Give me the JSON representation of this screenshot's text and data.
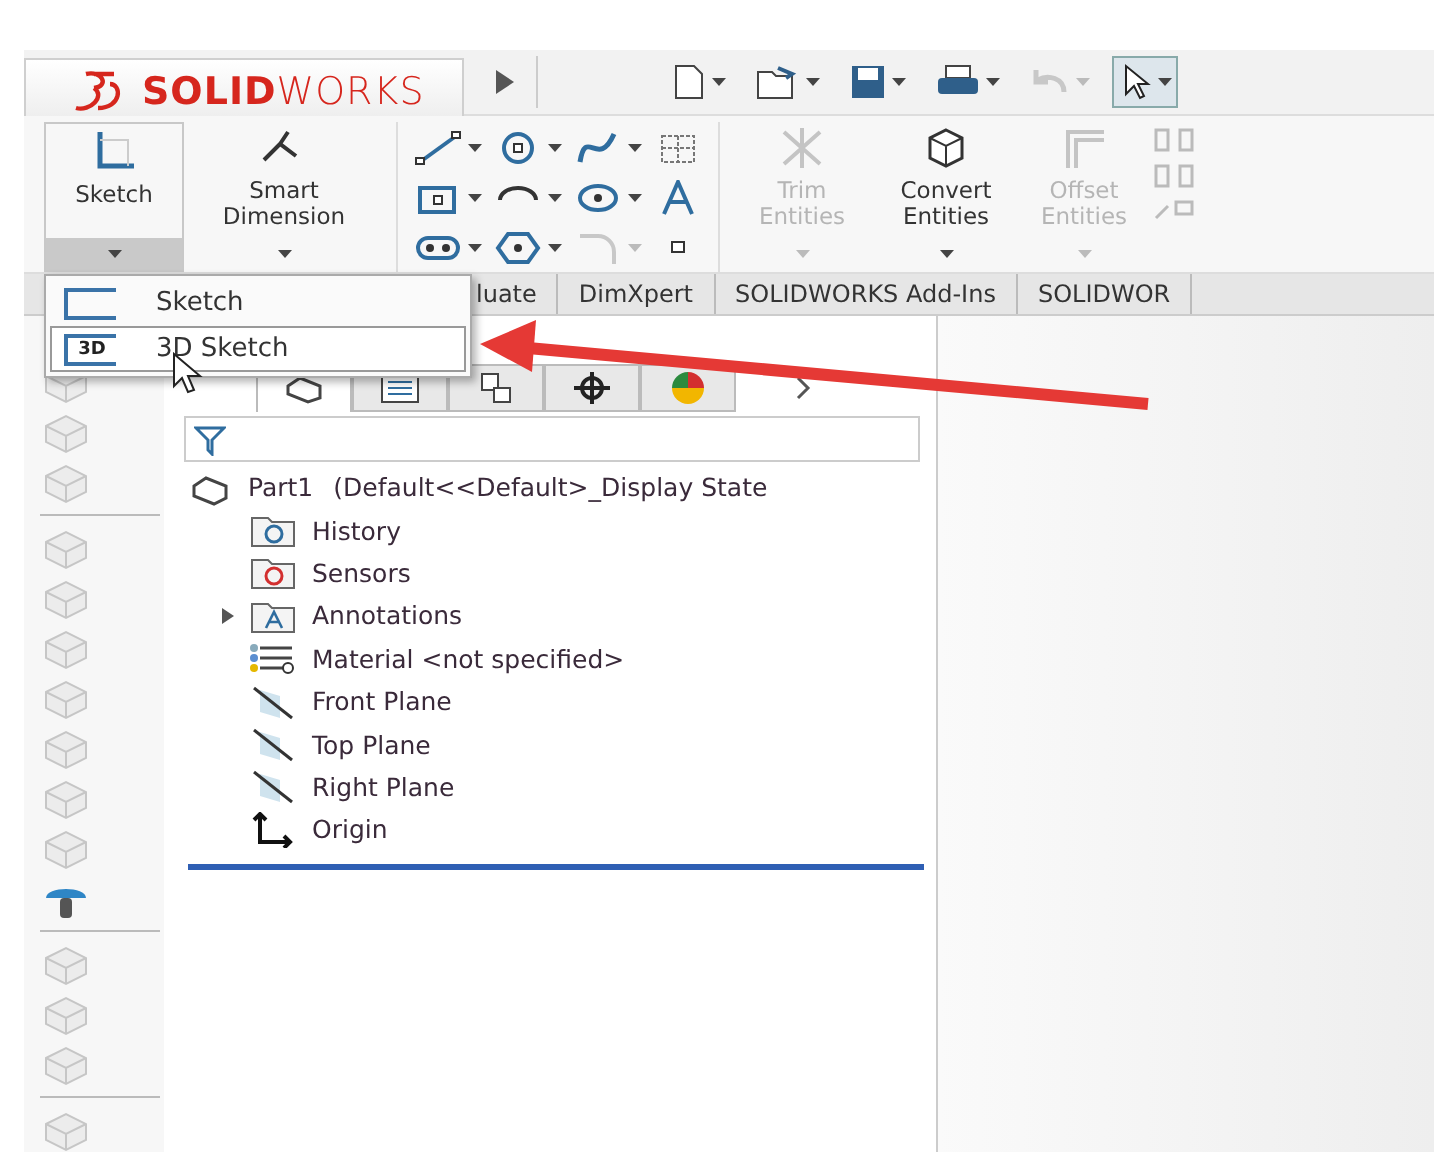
{
  "logo": {
    "text": "**SOLID**WORKS"
  },
  "quick_access": [
    {
      "kind": "new",
      "disabled": false
    },
    {
      "kind": "open",
      "disabled": false
    },
    {
      "kind": "save",
      "disabled": false
    },
    {
      "kind": "print",
      "disabled": false
    },
    {
      "kind": "undo",
      "disabled": true
    },
    {
      "kind": "select",
      "disabled": false,
      "selected": true
    }
  ],
  "ribbon": {
    "buttons": [
      {
        "kind": "sketch",
        "label": "Sketch",
        "disabled": false,
        "open": true
      },
      {
        "kind": "dimension",
        "label": "Smart Dimension",
        "disabled": false,
        "open": false
      },
      {
        "kind": "trim",
        "label": "Trim Entities",
        "disabled": true,
        "open": false
      },
      {
        "kind": "convert",
        "label": "Convert Entities",
        "disabled": false,
        "open": false
      },
      {
        "kind": "offset",
        "label": "Offset Entities",
        "disabled": true,
        "open": false
      }
    ],
    "tools": [
      {
        "kind": "line",
        "disabled": false
      },
      {
        "kind": "circle",
        "disabled": false
      },
      {
        "kind": "spline",
        "disabled": false
      },
      {
        "kind": "grid",
        "disabled": false
      },
      {
        "kind": "rect",
        "disabled": false
      },
      {
        "kind": "arc",
        "disabled": false
      },
      {
        "kind": "ellipse",
        "disabled": false
      },
      {
        "kind": "text",
        "disabled": false
      },
      {
        "kind": "slot",
        "disabled": false
      },
      {
        "kind": "polygon",
        "disabled": false
      },
      {
        "kind": "fillet",
        "disabled": true
      },
      {
        "kind": "point",
        "disabled": false
      }
    ]
  },
  "tabs": [
    "luate",
    "DimXpert",
    "SOLIDWORKS Add-Ins",
    "SOLIDWOR"
  ],
  "menu": [
    {
      "label": "Sketch",
      "selected": false
    },
    {
      "label": "3D Sketch",
      "icon_text": "3D",
      "selected": true
    }
  ],
  "left_toolbar": [
    {
      "kind": "tool",
      "disabled": true
    },
    {
      "kind": "tool",
      "disabled": true
    },
    {
      "kind": "tool",
      "disabled": true
    },
    {
      "kind": "separator"
    },
    {
      "kind": "tool",
      "disabled": true
    },
    {
      "kind": "tool",
      "disabled": true
    },
    {
      "kind": "tool",
      "disabled": true
    },
    {
      "kind": "tool",
      "disabled": true
    },
    {
      "kind": "tool",
      "disabled": true
    },
    {
      "kind": "tool",
      "disabled": true
    },
    {
      "kind": "tool",
      "disabled": true
    },
    {
      "kind": "tool",
      "disabled": false
    },
    {
      "kind": "separator"
    },
    {
      "kind": "tool",
      "disabled": true
    },
    {
      "kind": "tool",
      "disabled": true
    },
    {
      "kind": "tool",
      "disabled": true
    },
    {
      "kind": "separator"
    },
    {
      "kind": "tool",
      "disabled": true
    }
  ],
  "panel_tabs": [
    {
      "kind": "tree",
      "selected": true
    },
    {
      "kind": "properties",
      "selected": false
    },
    {
      "kind": "config",
      "selected": false
    },
    {
      "kind": "target",
      "selected": false
    },
    {
      "kind": "appearance",
      "selected": false
    }
  ],
  "tree": {
    "root": {
      "name": "Part1",
      "config": "(Default<<Default>_Display State"
    },
    "items": [
      {
        "kind": "history",
        "label": "History"
      },
      {
        "kind": "sensors",
        "label": "Sensors"
      },
      {
        "kind": "annotations",
        "label": "Annotations",
        "expanded": false
      },
      {
        "kind": "material",
        "label": "Material <not specified>"
      },
      {
        "kind": "plane",
        "label": "Front Plane"
      },
      {
        "kind": "plane",
        "label": "Top Plane"
      },
      {
        "kind": "plane",
        "label": "Right Plane"
      },
      {
        "kind": "origin",
        "label": "Origin"
      }
    ]
  }
}
